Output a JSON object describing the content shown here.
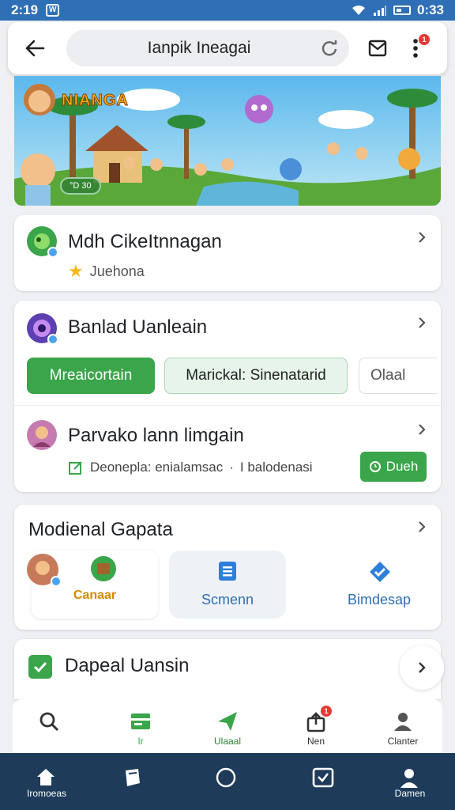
{
  "status": {
    "time_left": "2:19",
    "badge": "W",
    "time_right": "0:33"
  },
  "browser": {
    "url": "Ianpik Ineagai",
    "menu_badge": "1"
  },
  "hero": {
    "title": "NIANGA",
    "chip": "°D 30"
  },
  "cards": {
    "first": {
      "title": "Mdh CikeItnnagan",
      "subtitle": "Juehona"
    },
    "second": {
      "title": "Banlad Uanleain",
      "buttons": [
        "Mreaicortain",
        "Marickal: Sinenatarid",
        "Olaal"
      ],
      "subrow": {
        "title": "Parvako lann limgain",
        "meta_left": "Deonepla: enialamsac",
        "meta_sep": "·",
        "meta_right": "I balodenasi",
        "action": "Dueh"
      }
    },
    "third": {
      "title": "Modienal Gapata",
      "items": [
        "Canaar",
        "Scmenn",
        "Bimdesap"
      ]
    },
    "fourth": {
      "title": "Dapeal Uansin"
    }
  },
  "tabs": [
    {
      "label": "",
      "icon": "search-icon"
    },
    {
      "label": "Ir",
      "icon": "card-icon"
    },
    {
      "label": "Ulaaal",
      "icon": "plane-icon"
    },
    {
      "label": "Nen",
      "icon": "share-icon",
      "badge": "1"
    },
    {
      "label": "Clanter",
      "icon": "person-icon"
    }
  ],
  "nav": [
    {
      "label": "Iromoeas",
      "icon": "home-icon"
    },
    {
      "label": "",
      "icon": "bookmark-icon"
    },
    {
      "label": "",
      "icon": "circle-icon"
    },
    {
      "label": "",
      "icon": "inbox-icon"
    },
    {
      "label": "Damen",
      "icon": "profile-icon"
    }
  ],
  "colors": {
    "accent_green": "#3aa54a",
    "status_bar": "#2f6fb6",
    "nav_bar": "#1e3b5a"
  }
}
